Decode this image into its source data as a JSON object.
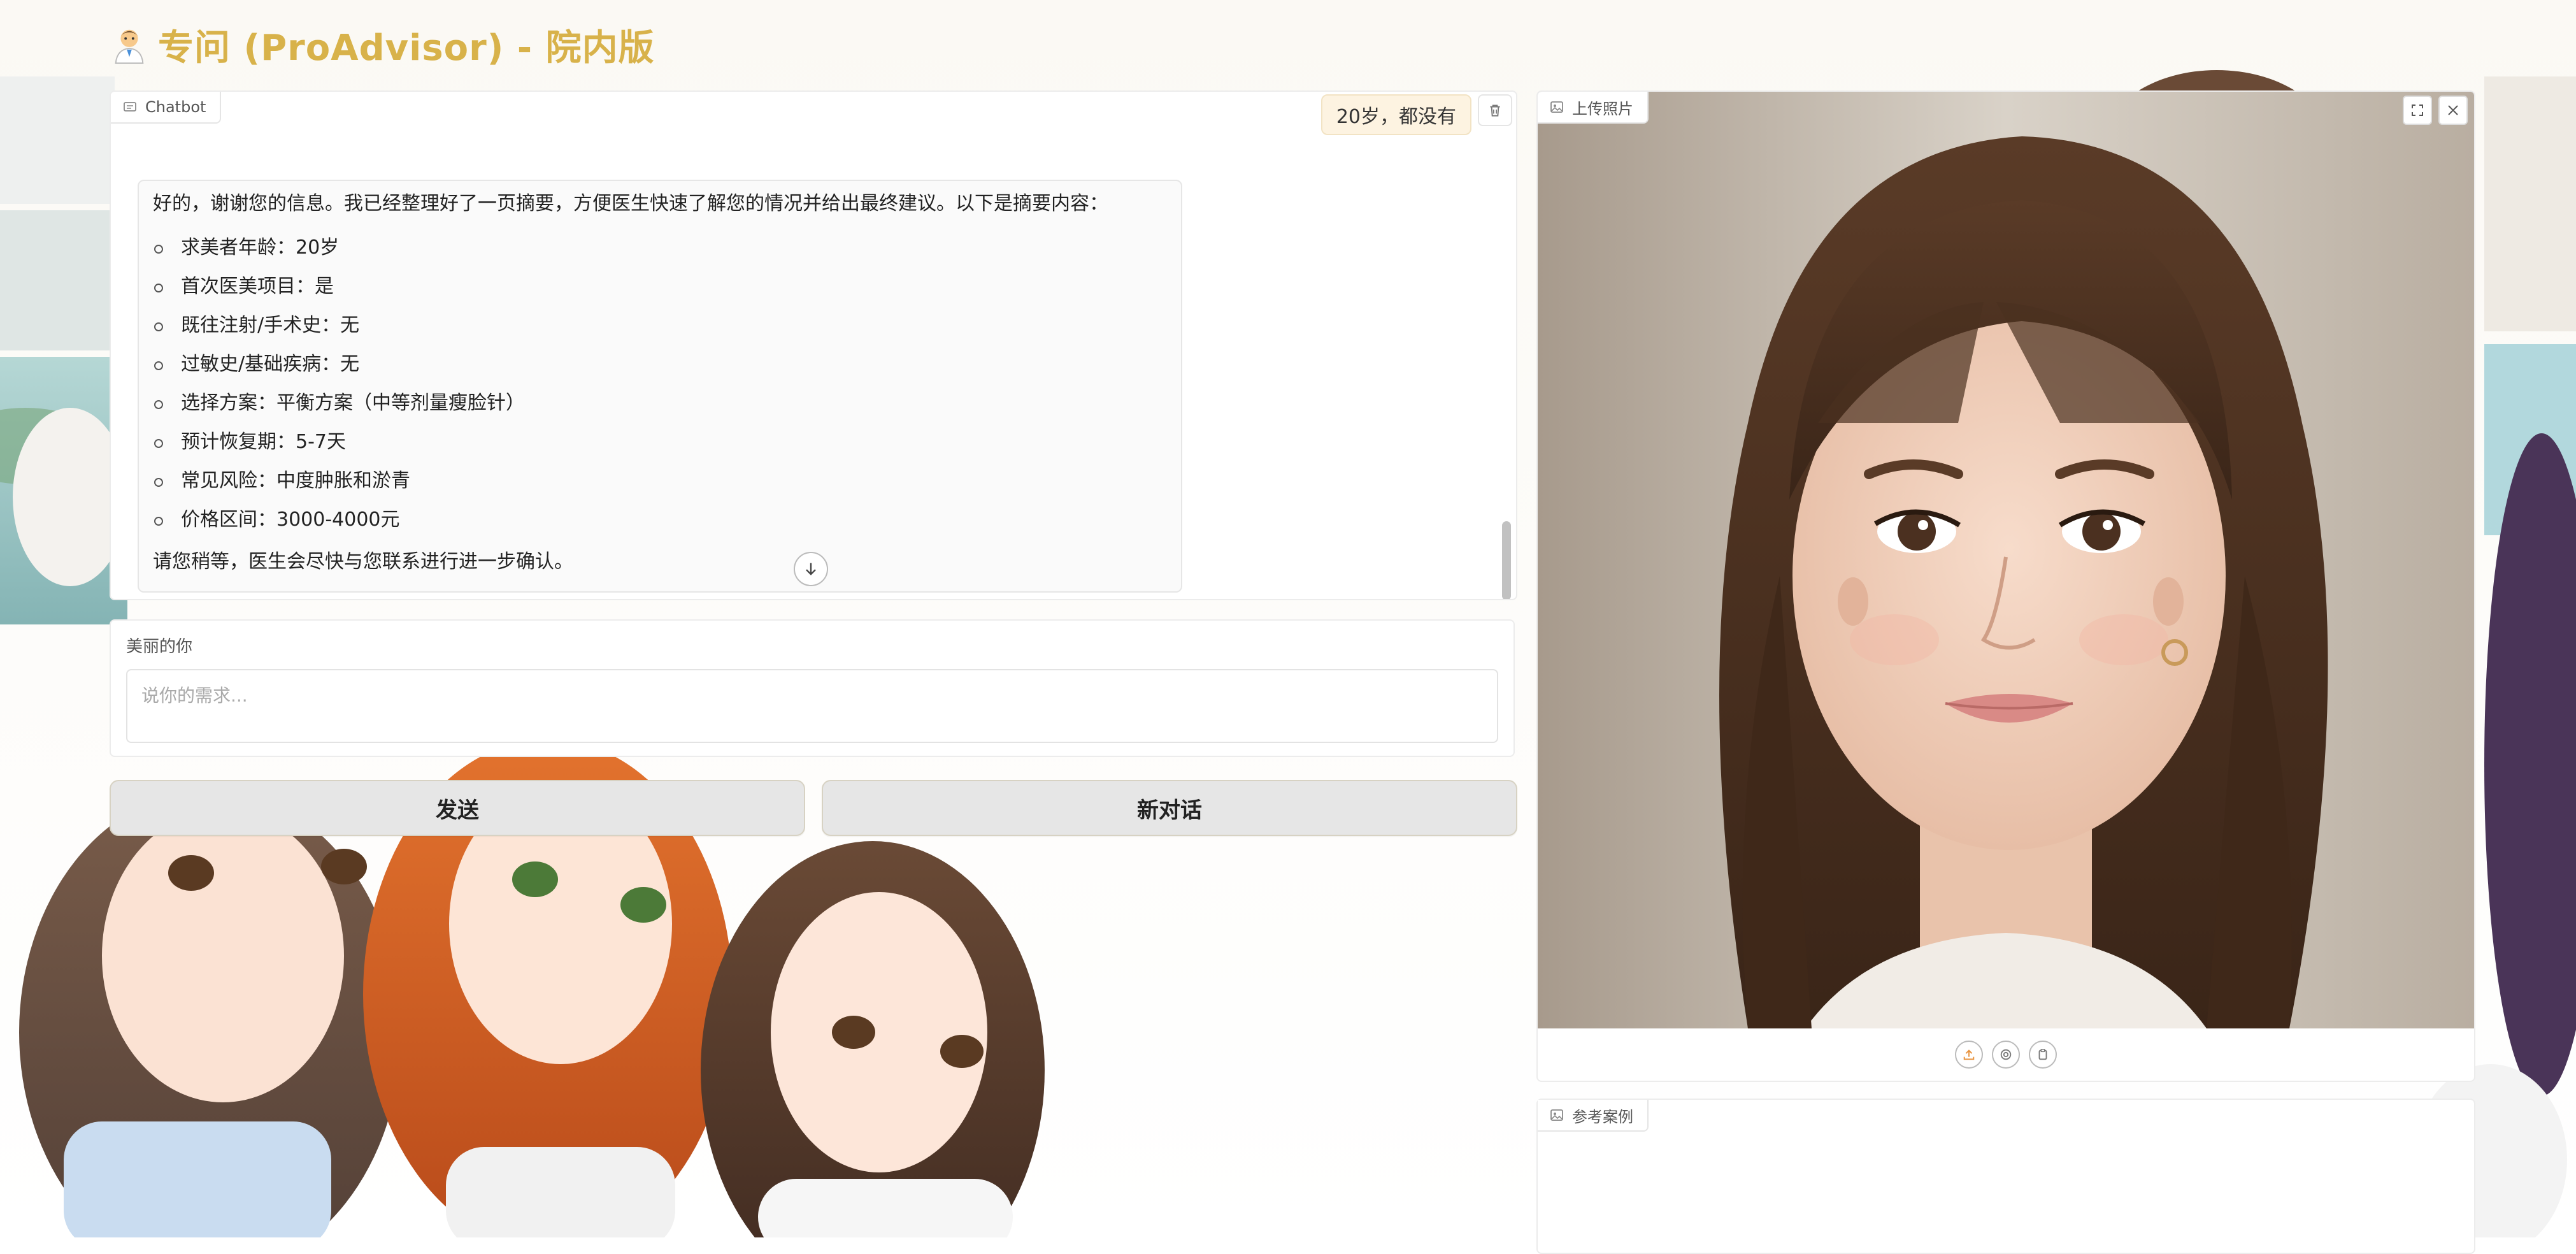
{
  "header": {
    "title": "专问 (ProAdvisor) - 院内版",
    "logo_icon": "doctor-emoji-icon"
  },
  "chatbot": {
    "label": "Chatbot",
    "user_message": "20岁，都没有",
    "bot_message": {
      "intro": "好的，谢谢您的信息。我已经整理好了一页摘要，方便医生快速了解您的情况并给出最终建议。以下是摘要内容：",
      "items": [
        "求美者年龄：20岁",
        "首次医美项目：是",
        "既往注射/手术史：无",
        "过敏史/基础疾病：无",
        "选择方案：平衡方案（中等剂量瘦脸针）",
        "预计恢复期：5-7天",
        "常见风险：中度肿胀和淤青",
        "价格区间：3000-4000元"
      ],
      "outro": "请您稍等，医生会尽快与您联系进行进一步确认。"
    }
  },
  "input": {
    "label": "美丽的你",
    "placeholder": "说你的需求..."
  },
  "buttons": {
    "send": "发送",
    "new_chat": "新对话"
  },
  "upload": {
    "label": "上传照片"
  },
  "reference": {
    "label": "参考案例"
  },
  "colors": {
    "title": "#d8b24a",
    "user_bubble": "#fdf3e1",
    "accent_orange": "#e8913a"
  }
}
